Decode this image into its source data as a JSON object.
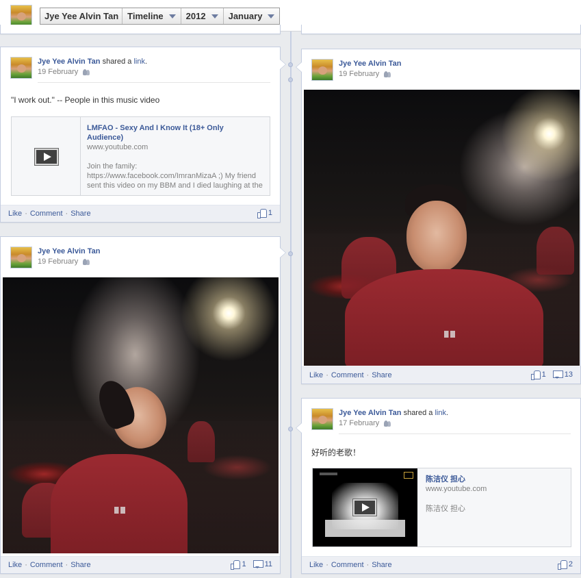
{
  "header": {
    "name_label": "Jye Yee Alvin Tan",
    "view_label": "Timeline",
    "year_label": "2012",
    "month_label": "January"
  },
  "posts": [
    {
      "author": "Jye Yee Alvin Tan",
      "action_text": " shared a ",
      "action_link": "link",
      "action_end": ".",
      "date": "19 February",
      "message": "\"I work out.\" -- People in this music video",
      "link": {
        "title": "LMFAO - Sexy And I Know It (18+ Only Audience)",
        "domain": "www.youtube.com",
        "description": "Join the family: https://www.facebook.com/ImranMizaA ;) My friend sent this video on my BBM and I died laughing at the"
      },
      "actions": {
        "like": "Like",
        "comment": "Comment",
        "share": "Share",
        "sep": "·"
      },
      "like_count": "1"
    },
    {
      "author": "Jye Yee Alvin Tan",
      "date": "19 February",
      "actions": {
        "like": "Like",
        "comment": "Comment",
        "share": "Share",
        "sep": "·"
      },
      "like_count": "1",
      "comment_count": "11"
    },
    {
      "author": "Jye Yee Alvin Tan",
      "date": "19 February",
      "actions": {
        "like": "Like",
        "comment": "Comment",
        "share": "Share",
        "sep": "·"
      },
      "like_count": "1",
      "comment_count": "13"
    },
    {
      "author": "Jye Yee Alvin Tan",
      "action_text": " shared a ",
      "action_link": "link",
      "action_end": ".",
      "date": "17 February",
      "message": "好听的老歌！",
      "link": {
        "title": "陈洁仪 担心",
        "domain": "www.youtube.com",
        "description": "陈洁仪 担心"
      },
      "actions": {
        "like": "Like",
        "comment": "Comment",
        "share": "Share",
        "sep": "·"
      },
      "like_count": "2"
    }
  ],
  "colors": {
    "link": "#3b5998",
    "background": "#e9ebee",
    "action_bar": "#edeff4"
  }
}
